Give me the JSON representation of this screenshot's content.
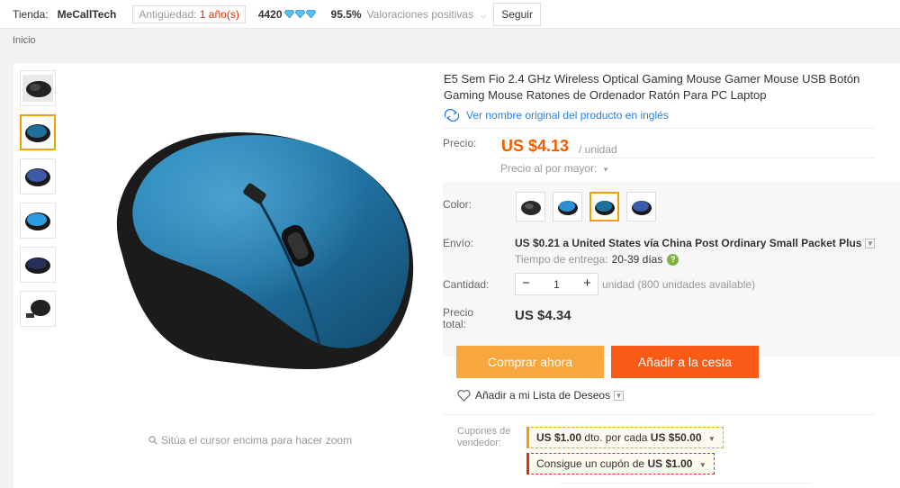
{
  "store": {
    "label": "Tienda:",
    "name": "MeCallTech",
    "age_label": "Antigüedad:",
    "age_value": "1 año(s)",
    "score": "4420",
    "positive_pct": "95.5%",
    "positive_label": "Valoraciones positivas",
    "follow_button": "Seguir",
    "accent_color": "#e62e04"
  },
  "breadcrumb": {
    "home": "Inicio"
  },
  "gallery": {
    "thumbnails": [
      {
        "name": "mouse-black",
        "color": "#222"
      },
      {
        "name": "mouse-blue",
        "color": "#1f6f9e"
      },
      {
        "name": "mouse-navy",
        "color": "#3b5aa8"
      },
      {
        "name": "mouse-light-blue",
        "color": "#2a9ee0"
      },
      {
        "name": "mouse-dark-blue",
        "color": "#27305c"
      },
      {
        "name": "mouse-with-receiver",
        "color": "#222"
      }
    ],
    "zoom_hint": "Sitúa el cursor encima para hacer zoom"
  },
  "product": {
    "title": "E5 Sem Fio 2.4 GHz Wireless Optical Gaming Mouse Gamer Mouse USB Botón Gaming Mouse Ratones de Ordenador Ratón Para PC Laptop",
    "original_name_link": "Ver nombre original del producto en inglés",
    "price_label": "Precio:",
    "price": "US $4.13",
    "per_unit": "/ unidad",
    "wholesale": "Precio al por mayor:",
    "color_label": "Color:",
    "swatches": [
      {
        "name": "black",
        "color": "#2a2a2a"
      },
      {
        "name": "light-blue",
        "color": "#2b8fd8"
      },
      {
        "name": "blue-selected",
        "color": "#1f6f9e"
      },
      {
        "name": "navy",
        "color": "#3b5aa8"
      }
    ],
    "shipping_label": "Envío:",
    "shipping_text": "US $0.21 a United States vía China Post Ordinary Small Packet Plus",
    "delivery_label": "Tiempo de entrega:",
    "delivery_days": "20-39 días",
    "quantity_label": "Cantidad:",
    "quantity": "1",
    "availability": "unidad (800 unidades available)",
    "total_label_1": "Precio",
    "total_label_2": "total:",
    "total": "US $4.34",
    "buy_now": "Comprar ahora",
    "add_to_cart": "Añadir a la cesta",
    "wishlist": "Añadir a mi Lista de Deseos",
    "price_color": "#f25d00",
    "buy_color": "#f7a73c",
    "cart_color": "#f95b16"
  },
  "coupons": {
    "label_1": "Cupones de",
    "label_2": "vendedor:",
    "coupon1_amount": "US $1.00",
    "coupon1_text": "dto. por cada",
    "coupon1_threshold": "US $50.00",
    "coupon2_text": "Consigue un cupón de",
    "coupon2_amount": "US $1.00"
  }
}
